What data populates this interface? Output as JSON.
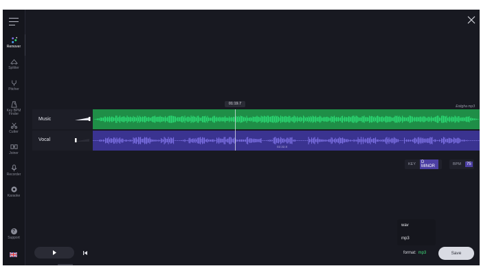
{
  "sidebar": {
    "items": [
      {
        "label": "Remover",
        "icon": "remover-icon",
        "active": true
      },
      {
        "label": "Splitter",
        "icon": "splitter-icon"
      },
      {
        "label": "Pitcher",
        "icon": "pitcher-icon"
      },
      {
        "label": "Key BPM Finder",
        "icon": "key-bpm-icon"
      },
      {
        "label": "Cutter",
        "icon": "cutter-icon"
      },
      {
        "label": "Joiner",
        "icon": "joiner-icon"
      },
      {
        "label": "Recorder",
        "icon": "recorder-icon"
      },
      {
        "label": "Karaoke",
        "icon": "karaoke-icon"
      }
    ],
    "support_label": "Support",
    "flag": "uk-flag-icon"
  },
  "tracks": {
    "music_label": "Music",
    "vocal_label": "Vocal",
    "music_volume": 1.0,
    "vocal_volume": 0.0,
    "playhead_time": "01:19.7",
    "vocal_time": "02:32.8",
    "filename": "Estigha mp3"
  },
  "analysis": {
    "key_label": "KEY",
    "key_value": "D MINOR",
    "bpm_label": "BPM",
    "bpm_value": "75"
  },
  "export": {
    "options": [
      "wav",
      "mp3"
    ],
    "format_label": "format:",
    "format_value": "mp3",
    "save_label": "Save"
  },
  "colors": {
    "background": "#181921",
    "music_wave": "#2bd873",
    "music_bg": "#1f8e47",
    "vocal_wave": "#7a6ee0",
    "vocal_bg": "#3a3390",
    "accent": "#4c3fa3"
  }
}
